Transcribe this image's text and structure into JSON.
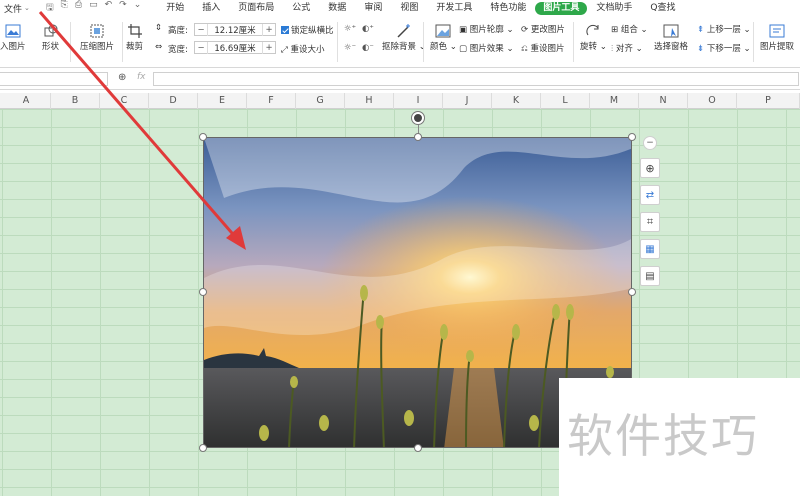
{
  "menubar": {
    "file_label": "文件",
    "tabs": [
      "开始",
      "插入",
      "页面布局",
      "公式",
      "数据",
      "审阅",
      "视图",
      "开发工具",
      "特色功能",
      "图片工具",
      "文档助手"
    ],
    "search_label": "Q查找"
  },
  "ribbon": {
    "insert_image": "入图片",
    "shape": "形状",
    "compress": "压缩图片",
    "crop": "裁剪",
    "height_label": "高度:",
    "height_value": "12.12厘米",
    "width_label": "宽度:",
    "width_value": "16.69厘米",
    "lock_ratio": "锁定纵横比",
    "reset_size": "重设大小",
    "remove_bg": "抠除背景",
    "color": "颜色",
    "outline": "图片轮廓",
    "effect": "图片效果",
    "change_image": "更改图片",
    "reset_image": "重设图片",
    "rotate": "旋转",
    "group": "组合",
    "align": "对齐",
    "selection_pane": "选择窗格",
    "bring_forward": "上移一层",
    "send_backward": "下移一层",
    "extract": "图片提取"
  },
  "formula": {
    "fx": "fx"
  },
  "columns": [
    "A",
    "B",
    "C",
    "D",
    "E",
    "F",
    "G",
    "H",
    "I",
    "J",
    "K",
    "L",
    "M",
    "N",
    "O",
    "P"
  ],
  "watermark": "软件技巧",
  "colors": {
    "accent": "#2ea84a",
    "sheet_bg": "#d3ebd4",
    "arrow": "#e03a3a"
  }
}
